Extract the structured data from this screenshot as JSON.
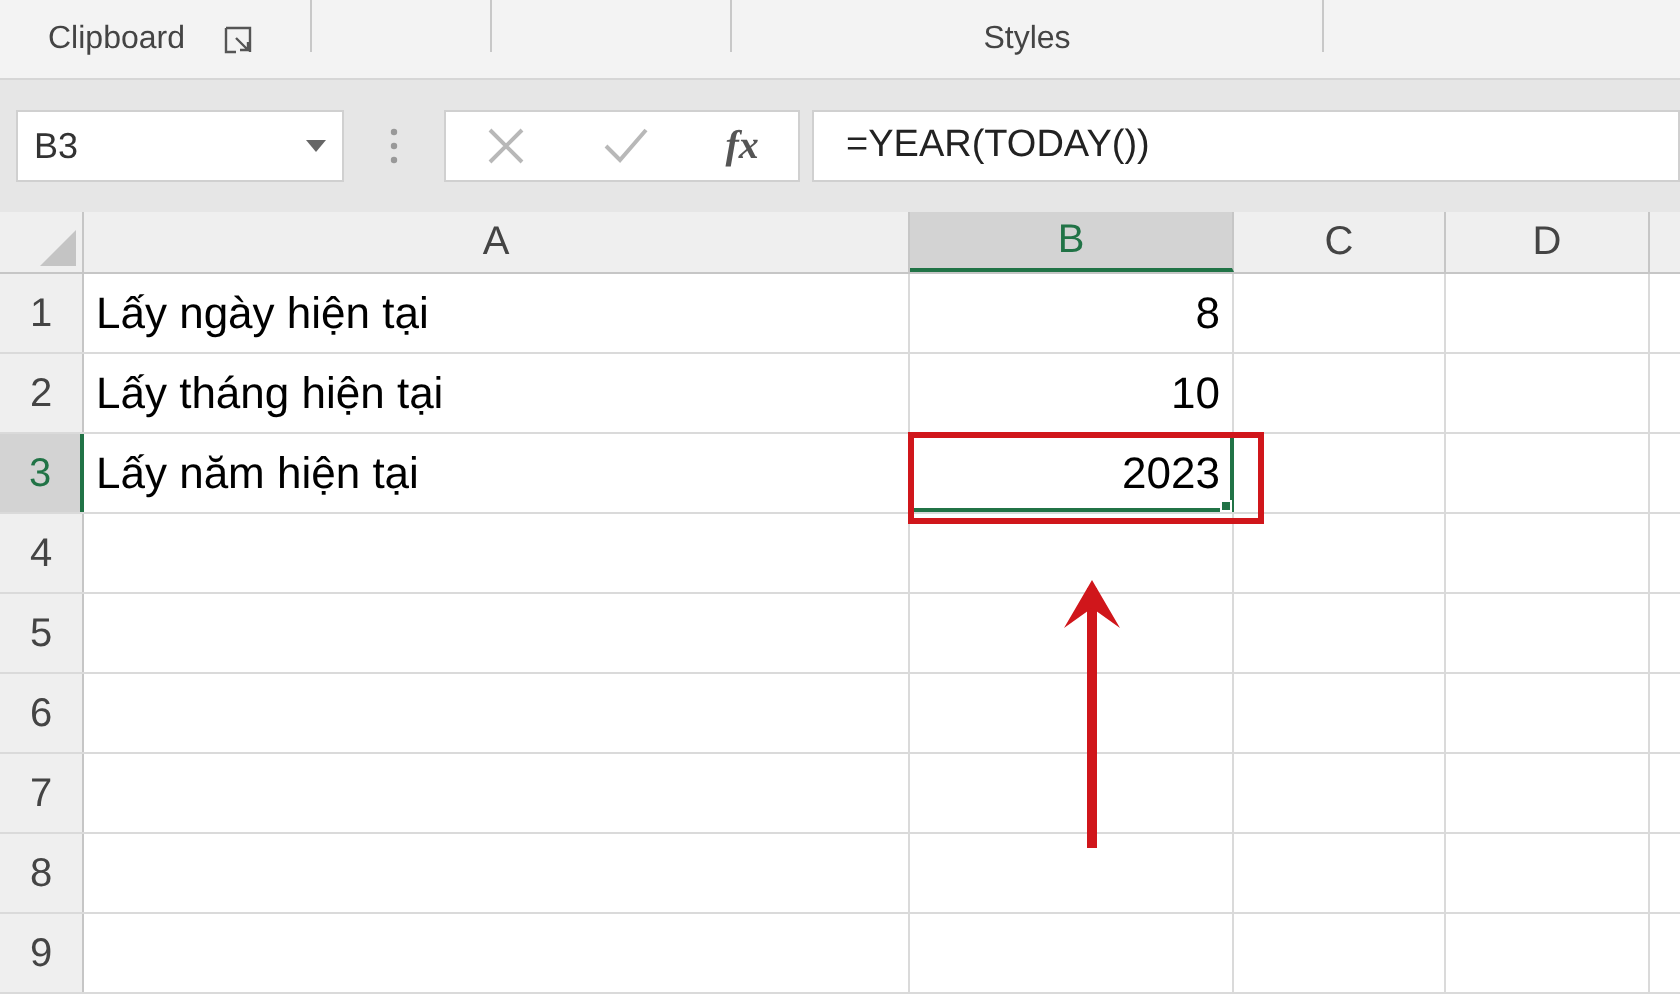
{
  "ribbon": {
    "groups": [
      {
        "label": "Clipboard",
        "launcher": true
      },
      {
        "label": "Styles",
        "launcher": false
      }
    ]
  },
  "formula_bar": {
    "name_box": "B3",
    "fx": "fx",
    "formula": "=YEAR(TODAY())"
  },
  "sheet": {
    "columns": [
      {
        "label": "A",
        "selected": false
      },
      {
        "label": "B",
        "selected": true
      },
      {
        "label": "C",
        "selected": false
      },
      {
        "label": "D",
        "selected": false
      }
    ],
    "rows": [
      {
        "label": "1",
        "selected": false,
        "cells": [
          {
            "kind": "text",
            "text": "Lấy ngày hiện tại",
            "selected": false
          },
          {
            "kind": "number",
            "text": "8",
            "selected": false
          }
        ]
      },
      {
        "label": "2",
        "selected": false,
        "cells": [
          {
            "kind": "text",
            "text": "Lấy tháng hiện tại",
            "selected": false
          },
          {
            "kind": "number",
            "text": "10",
            "selected": false
          }
        ]
      },
      {
        "label": "3",
        "selected": true,
        "cells": [
          {
            "kind": "text",
            "text": "Lấy năm hiện tại",
            "selected": false
          },
          {
            "kind": "number",
            "text": "2023",
            "selected": true
          }
        ]
      },
      {
        "label": "4",
        "selected": false
      },
      {
        "label": "5",
        "selected": false
      },
      {
        "label": "6",
        "selected": false
      },
      {
        "label": "7",
        "selected": false
      },
      {
        "label": "8",
        "selected": false
      },
      {
        "label": "9",
        "selected": false
      }
    ]
  }
}
